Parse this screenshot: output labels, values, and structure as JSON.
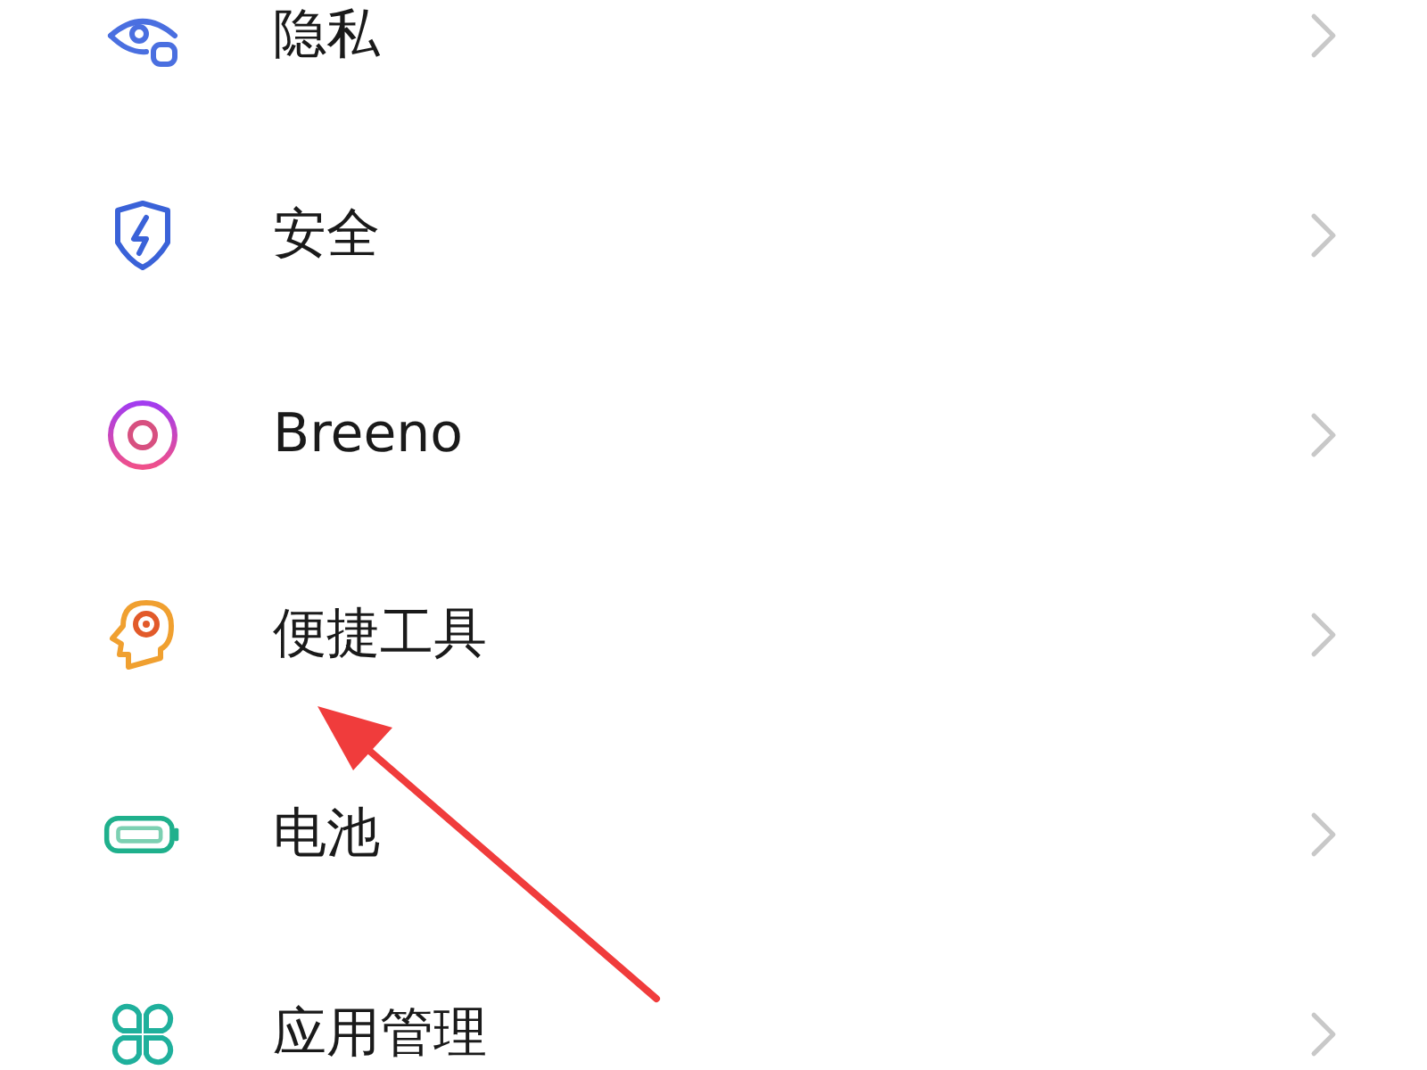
{
  "settings_items": [
    {
      "kind": "privacy",
      "label": "隐私"
    },
    {
      "kind": "security",
      "label": "安全"
    },
    {
      "kind": "assistant",
      "label": "Breeno"
    },
    {
      "kind": "tools",
      "label": "便捷工具"
    },
    {
      "kind": "battery",
      "label": "电池"
    },
    {
      "kind": "apps",
      "label": "应用管理"
    }
  ]
}
